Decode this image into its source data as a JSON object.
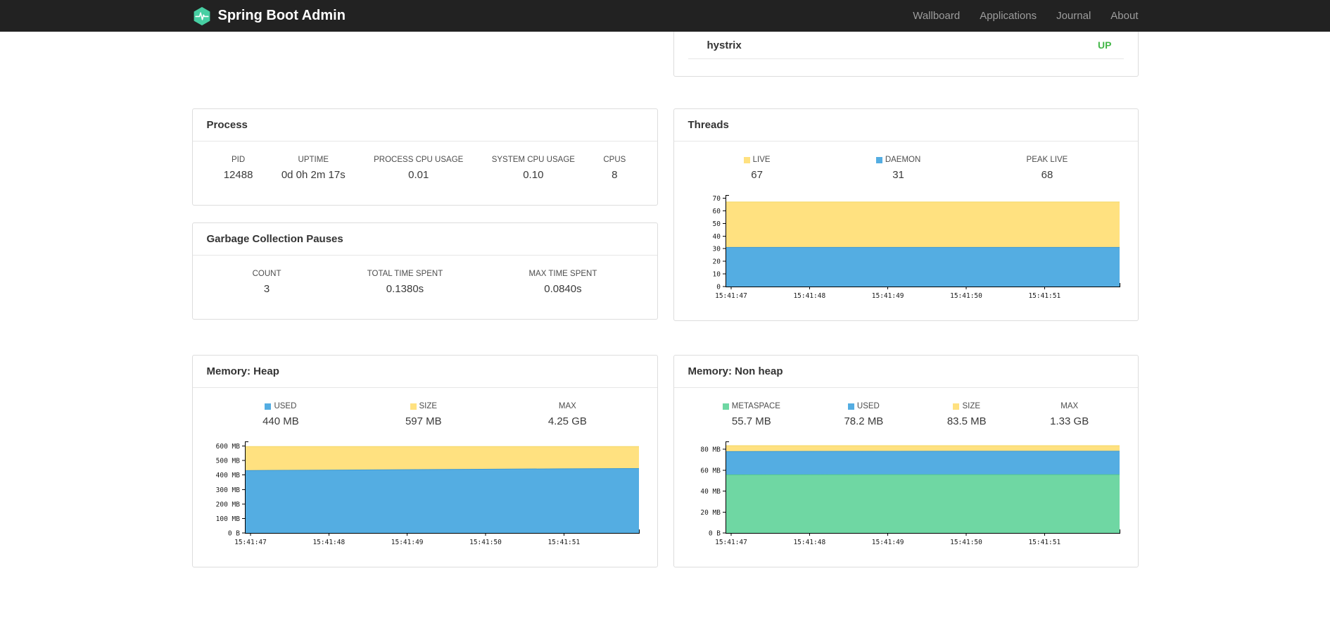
{
  "colors": {
    "yellow": "#ffe180",
    "yellow_stroke": "#f3d express66",
    "blue": "#54ade2",
    "blue_stroke": "#3f9ad3",
    "green": "#6fd7a3",
    "green_stroke": "#54c98f",
    "status_up": "#44b749",
    "brand_logo": "#47cfa3"
  },
  "navbar": {
    "brand": "Spring Boot Admin",
    "links": [
      {
        "label": "Wallboard"
      },
      {
        "label": "Applications"
      },
      {
        "label": "Journal"
      },
      {
        "label": "About"
      }
    ]
  },
  "health_panel": {
    "rows": [
      {
        "name": "hystrix",
        "status": "UP"
      }
    ]
  },
  "process_panel": {
    "title": "Process",
    "metrics": [
      {
        "label": "PID",
        "value": "12488"
      },
      {
        "label": "UPTIME",
        "value": "0d 0h 2m 17s"
      },
      {
        "label": "PROCESS CPU USAGE",
        "value": "0.01"
      },
      {
        "label": "SYSTEM CPU USAGE",
        "value": "0.10"
      },
      {
        "label": "CPUS",
        "value": "8"
      }
    ]
  },
  "gc_panel": {
    "title": "Garbage Collection Pauses",
    "metrics": [
      {
        "label": "COUNT",
        "value": "3"
      },
      {
        "label": "TOTAL TIME SPENT",
        "value": "0.1380s"
      },
      {
        "label": "MAX TIME SPENT",
        "value": "0.0840s"
      }
    ]
  },
  "threads_panel": {
    "title": "Threads",
    "metrics": [
      {
        "label": "LIVE",
        "value": "67",
        "swatch": "yellow"
      },
      {
        "label": "DAEMON",
        "value": "31",
        "swatch": "blue"
      },
      {
        "label": "PEAK LIVE",
        "value": "68"
      }
    ]
  },
  "heap_panel": {
    "title": "Memory: Heap",
    "metrics": [
      {
        "label": "USED",
        "value": "440 MB",
        "swatch": "blue"
      },
      {
        "label": "SIZE",
        "value": "597 MB",
        "swatch": "yellow"
      },
      {
        "label": "MAX",
        "value": "4.25 GB"
      }
    ]
  },
  "nonheap_panel": {
    "title": "Memory: Non heap",
    "metrics": [
      {
        "label": "METASPACE",
        "value": "55.7 MB",
        "swatch": "green"
      },
      {
        "label": "USED",
        "value": "78.2 MB",
        "swatch": "blue"
      },
      {
        "label": "SIZE",
        "value": "83.5 MB",
        "swatch": "yellow"
      },
      {
        "label": "MAX",
        "value": "1.33 GB"
      }
    ]
  },
  "chart_data": [
    {
      "panel": "threads",
      "type": "area",
      "stacked": true,
      "title": "Threads",
      "x_labels": [
        "15:41:47",
        "15:41:48",
        "15:41:49",
        "15:41:50",
        "15:41:51"
      ],
      "ylim": [
        0,
        72.5
      ],
      "yticks": [
        {
          "v": 0,
          "label": "0"
        },
        {
          "v": 10,
          "label": "10"
        },
        {
          "v": 20,
          "label": "20"
        },
        {
          "v": 30,
          "label": "30"
        },
        {
          "v": 40,
          "label": "40"
        },
        {
          "v": 50,
          "label": "50"
        },
        {
          "v": 60,
          "label": "60"
        },
        {
          "v": 70,
          "label": "70"
        }
      ],
      "layers": [
        {
          "name": "DAEMON",
          "color_key": "blue",
          "values": [
            31,
            31,
            31,
            31,
            31,
            31
          ]
        },
        {
          "name": "LIVE",
          "color_key": "yellow",
          "values": [
            67,
            67,
            67,
            67,
            67,
            67
          ]
        }
      ]
    },
    {
      "panel": "memory-heap",
      "type": "area",
      "stacked": true,
      "title": "Memory: Heap",
      "x_labels": [
        "15:41:47",
        "15:41:48",
        "15:41:49",
        "15:41:50",
        "15:41:51"
      ],
      "ylim": [
        0,
        632
      ],
      "yticks": [
        {
          "v": 0,
          "label": "0 B"
        },
        {
          "v": 100,
          "label": "100 MB"
        },
        {
          "v": 200,
          "label": "200 MB"
        },
        {
          "v": 300,
          "label": "300 MB"
        },
        {
          "v": 400,
          "label": "400 MB"
        },
        {
          "v": 500,
          "label": "500 MB"
        },
        {
          "v": 600,
          "label": "600 MB"
        }
      ],
      "layers": [
        {
          "name": "USED",
          "color_key": "blue",
          "values": [
            431,
            434,
            437,
            440,
            443,
            445
          ]
        },
        {
          "name": "SIZE",
          "color_key": "yellow",
          "values": [
            597,
            597,
            597,
            597,
            597,
            597
          ]
        }
      ]
    },
    {
      "panel": "memory-nonheap",
      "type": "area",
      "stacked": true,
      "title": "Memory: Non heap",
      "x_labels": [
        "15:41:47",
        "15:41:48",
        "15:41:49",
        "15:41:50",
        "15:41:51"
      ],
      "ylim": [
        0,
        87.5
      ],
      "yticks": [
        {
          "v": 0,
          "label": "0 B"
        },
        {
          "v": 20,
          "label": "20 MB"
        },
        {
          "v": 40,
          "label": "40 MB"
        },
        {
          "v": 60,
          "label": "60 MB"
        },
        {
          "v": 80,
          "label": "80 MB"
        }
      ],
      "layers": [
        {
          "name": "METASPACE",
          "color_key": "green",
          "values": [
            55.5,
            55.6,
            55.7,
            55.7,
            55.7,
            55.7
          ]
        },
        {
          "name": "USED",
          "color_key": "blue",
          "values": [
            77.8,
            78.0,
            78.1,
            78.2,
            78.2,
            78.2
          ]
        },
        {
          "name": "SIZE",
          "color_key": "yellow",
          "values": [
            83.5,
            83.5,
            83.5,
            83.5,
            83.5,
            83.5
          ]
        }
      ]
    }
  ]
}
